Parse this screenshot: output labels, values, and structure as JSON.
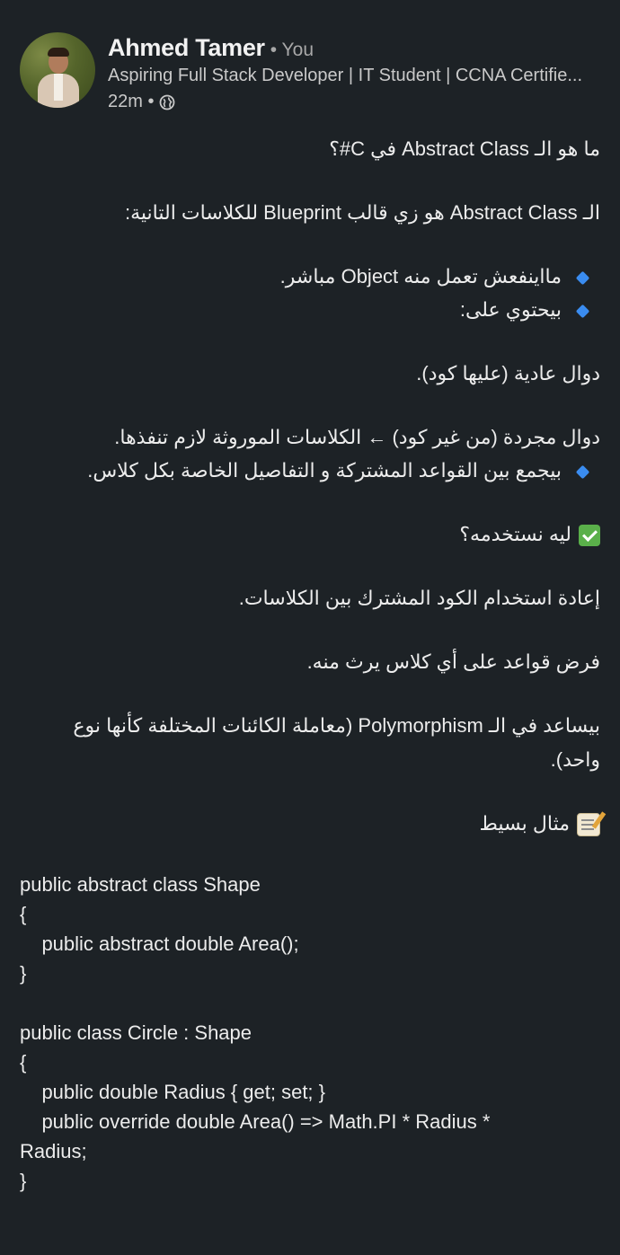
{
  "author": {
    "name": "Ahmed Tamer",
    "you_label": "• You",
    "headline": "Aspiring Full Stack Developer | IT Student | CCNA Certifie...",
    "time": "22m •",
    "visibility_icon": "globe-icon"
  },
  "post": {
    "title": "ما هو الـ Abstract Class في C#؟",
    "intro": "الـ Abstract Class هو زي قالب Blueprint للكلاسات التانية:",
    "bullet1": "مااينفعش تعمل منه Object مباشر.",
    "bullet2": "بيحتوي على:",
    "line_regular": "دوال عادية (عليها كود).",
    "line_abstract": "دوال مجردة (من غير كود) ← الكلاسات الموروثة لازم تنفذها.",
    "bullet3": "بيجمع بين القواعد المشتركة و التفاصيل الخاصة بكل كلاس.",
    "why_title": "ليه نستخدمه؟",
    "why1": "إعادة استخدام الكود المشترك بين الكلاسات.",
    "why2": "فرض قواعد على أي كلاس يرث منه.",
    "why3a": "بيساعد في الـ Polymorphism (معاملة الكائنات المختلفة كأنها نوع",
    "why3b": "واحد).",
    "example_title": "مثال بسيط",
    "code": [
      "public abstract class Shape",
      "{",
      "    public abstract double Area();",
      "}",
      "",
      "public class Circle : Shape",
      "{",
      "    public double Radius { get; set; }",
      "    public override double Area() => Math.PI * Radius *",
      "Radius;",
      "}"
    ]
  },
  "colors": {
    "background": "#1d2226",
    "bullet": "#3a8cf0",
    "check": "#5ab04a"
  }
}
